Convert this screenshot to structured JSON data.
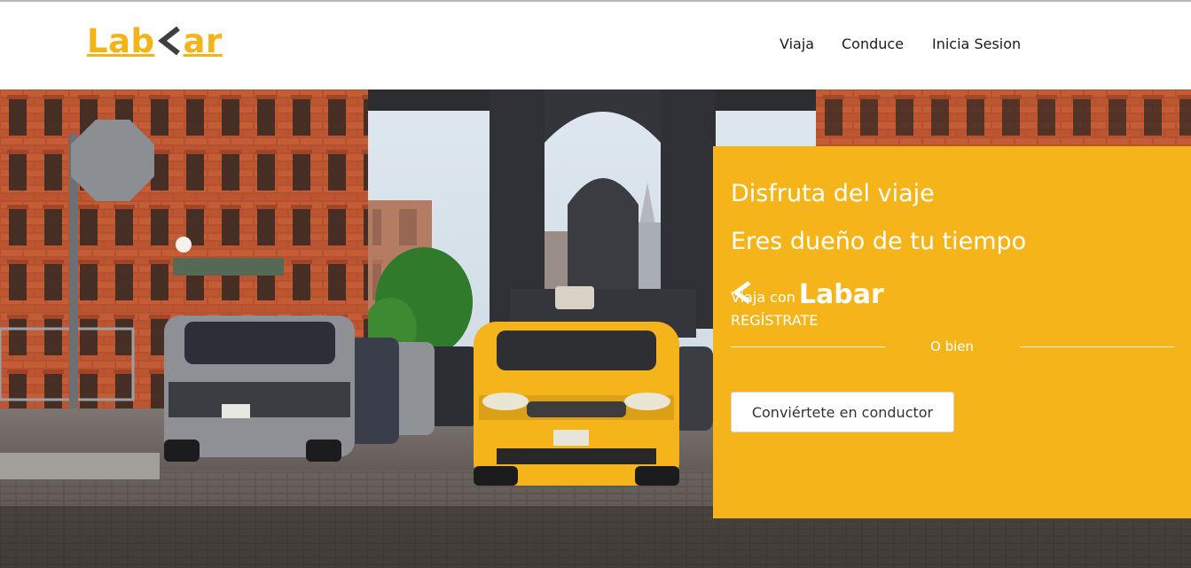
{
  "brand": {
    "logo_prefix": "Lab",
    "logo_suffix": "ar",
    "logo_color": "#f2b417",
    "logo_chevron_color": "#3f3f3f"
  },
  "nav": {
    "items": [
      {
        "label": "Viaja"
      },
      {
        "label": "Conduce"
      },
      {
        "label": "Inicia Sesion"
      }
    ]
  },
  "hero": {
    "scene": "city-street-taxi-photo"
  },
  "card": {
    "background": "#f5b51a",
    "headline_1": "Disfruta del viaje",
    "headline_2": "Eres dueño de tu tiempo",
    "viaja_con": "Viaja con",
    "register_link": "REGÍSTRATE",
    "divider_text": "O bien",
    "driver_button": "Conviértete en conductor"
  }
}
